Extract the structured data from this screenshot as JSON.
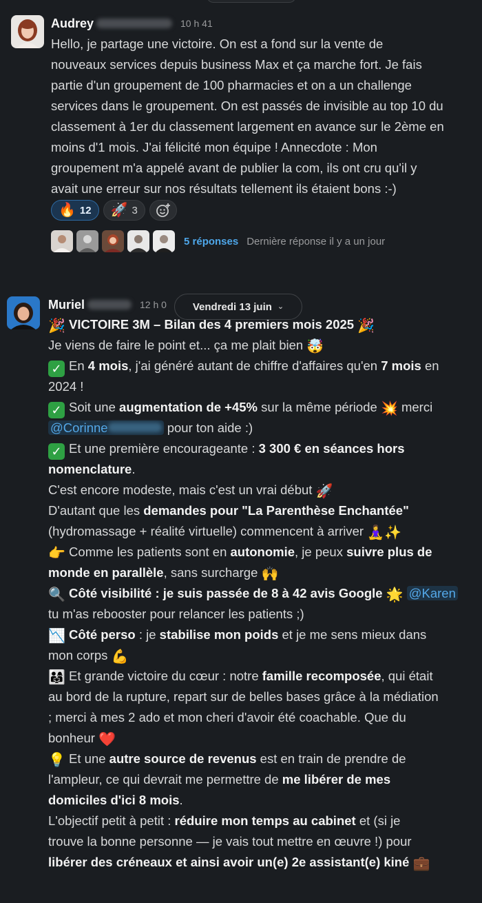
{
  "message1": {
    "author": "Audrey",
    "time": "10 h 41",
    "lines": [
      "Hello, je partage une victoire. On est a fond sur la vente de",
      "nouveaux services depuis business Max et ça marche fort. Je fais",
      "partie d'un groupement de 100 pharmacies et on a un challenge",
      "services dans le groupement. On est passés de invisible au top 10 du",
      "classement à 1er du classement largement en avance sur le 2ème en",
      "moins d'1 mois. J'ai félicité mon équipe ! Annecdote : Mon",
      "groupement m'a appelé avant de publier la com, ils ont cru qu'il y",
      "avait une erreur sur nos résultats tellement ils étaient bons :-)"
    ],
    "reactions": [
      {
        "emoji": "🔥",
        "count": "12",
        "icon": "fire-icon"
      },
      {
        "emoji": "🚀",
        "count": "3",
        "icon": "rocket-icon"
      }
    ],
    "add_reaction_icon": "add-reaction-icon",
    "thread": {
      "replies": "5 réponses",
      "last_reply": "Dernière réponse il y a un jour"
    }
  },
  "date_divider": {
    "label": "Vendredi 13 juin",
    "chevron": "⌄"
  },
  "message2": {
    "author": "Muriel",
    "time": "12 h 0",
    "title_pre": "VICTOIRE 3M – Bilan des 4 premiers mois 2025",
    "l1": "Je viens de faire le point et... ça me plait bien",
    "l2a": "En ",
    "l2b": "4 mois",
    "l2c": ", j'ai généré autant de chiffre d'affaires qu'en ",
    "l2d": "7 mois",
    "l2e": " en",
    "l3": "2024 !",
    "l4a": "Soit une ",
    "l4b": "augmentation de +45%",
    "l4c": " sur la même période",
    "l4d": " merci",
    "l5mention": "@Corinne",
    "l5b": " pour ton aide :)",
    "l6a": "Et une première encourageante : ",
    "l6b": "3 300 € en séances hors",
    "l7": "nomenclature",
    "l7b": ".",
    "l8": " C'est encore modeste, mais c'est un vrai début",
    "l9a": " D'autant que les ",
    "l9b": "demandes pour \"La Parenthèse Enchantée\"",
    "l10": "(hydromassage + réalité virtuelle) commencent à arriver",
    "l11a": " Comme les patients sont en ",
    "l11b": "autonomie",
    "l11c": ", je peux ",
    "l11d": "suivre plus de",
    "l12a": "monde en parallèle",
    "l12b": ", sans surcharge",
    "l13a": " Côté visibilité : je suis passée de 8 à 42 avis Google",
    "l13mention": "@Karen",
    "l14": "tu m'as rebooster pour relancer les patients ;)",
    "l15a": " Côté perso",
    "l15b": " : je ",
    "l15c": "stabilise mon poids",
    "l15d": " et je me sens mieux dans",
    "l16": "mon corps",
    "l17a": " Et grande victoire du cœur : notre ",
    "l17b": "famille recomposée",
    "l17c": ", qui était",
    "l18": "au bord de la rupture, repart sur de belles bases grâce à la médiation",
    "l19": "; merci à mes 2 ado et mon cheri d'avoir été coachable. Que du",
    "l20": "bonheur",
    "l21a": " Et une ",
    "l21b": "autre source de revenus",
    "l21c": " est en train de prendre de",
    "l22a": "l'ampleur, ce qui devrait me permettre de ",
    "l22b": "me libérer de mes",
    "l23a": "domiciles d'ici 8 mois",
    "l23b": ".",
    "l24a": " L'objectif petit à petit : ",
    "l24b": "réduire mon temps au cabinet",
    "l24c": " et (si je",
    "l25": "trouve la bonne personne — je vais tout mettre en œuvre !) pour",
    "l26a": "libérer des créneaux et ainsi avoir un(e) 2e assistant(e) kiné",
    "emoji": {
      "party": "🎉",
      "mindblown": "🤯",
      "check": "✓",
      "boom": "💥",
      "rocket": "🚀",
      "lotus": "🧘‍♀️",
      "sparkles": "✨",
      "point": "👉",
      "raise": "🙌",
      "search": "🔍",
      "star": "🌟",
      "chart_down": "📉",
      "muscle": "💪",
      "family": "👨‍👩‍👧",
      "heart": "❤️",
      "bulb": "💡",
      "briefcase": "💼"
    }
  }
}
